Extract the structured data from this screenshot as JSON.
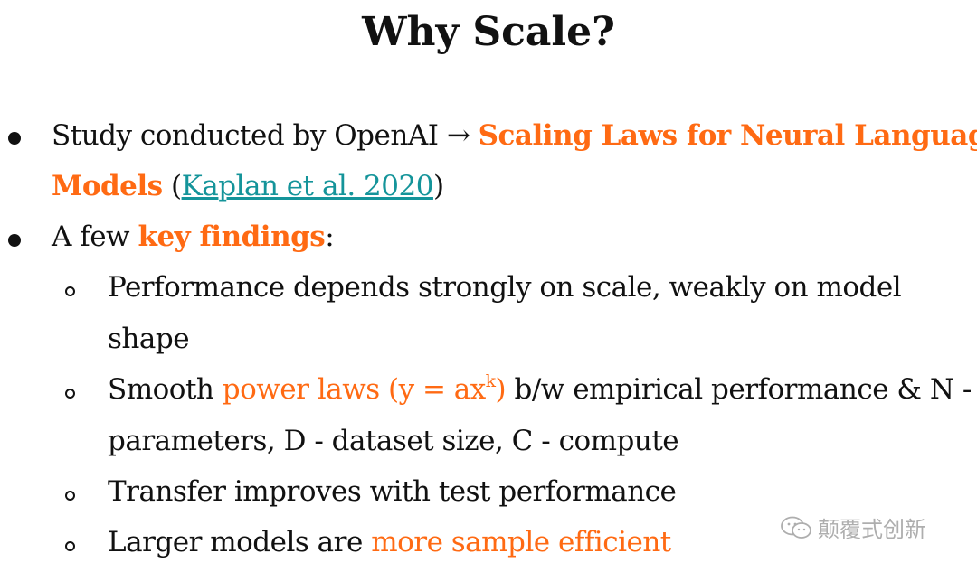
{
  "slide": {
    "title": "Why Scale?",
    "bullet1": {
      "text_a": "Study conducted by OpenAI",
      "arrow": "→",
      "accent_a": "Scaling Laws for Neural Language",
      "accent_b": "Models",
      "open_paren": "(",
      "link": "Kaplan et al. 2020",
      "close_paren": ")"
    },
    "bullet2": {
      "text_a": "A few",
      "accent": "key findings",
      "colon": ":"
    },
    "sub1": {
      "line1": "Performance depends strongly on scale, weakly on model",
      "line2": "shape"
    },
    "sub2": {
      "text_a": "Smooth",
      "accent_a": "power laws (y = ax",
      "accent_sup": "k",
      "accent_b": ")",
      "text_b": "b/w empirical performance & N -",
      "line2": "parameters, D - dataset size, C - compute"
    },
    "sub3": {
      "text": "Transfer improves with test performance"
    },
    "sub4": {
      "text_a": "Larger models are",
      "accent": "more sample efficient"
    }
  },
  "watermark": {
    "text": "颠覆式创新",
    "icon": "wechat-icon"
  },
  "colors": {
    "accent": "#ff6a13",
    "link": "#14949a",
    "text": "#111111"
  }
}
